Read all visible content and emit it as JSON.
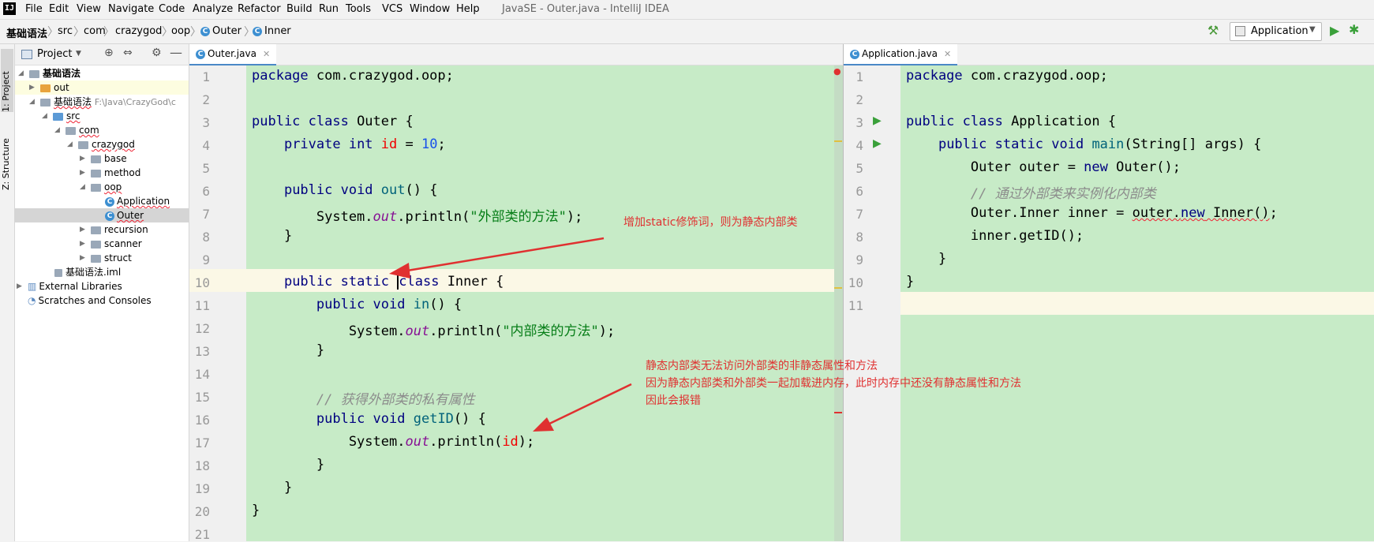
{
  "window_title": "JavaSE - Outer.java - IntelliJ IDEA",
  "menu": [
    "File",
    "Edit",
    "View",
    "Navigate",
    "Code",
    "Analyze",
    "Refactor",
    "Build",
    "Run",
    "Tools",
    "VCS",
    "Window",
    "Help"
  ],
  "breadcrumbs": [
    "基础语法",
    "src",
    "com",
    "crazygod",
    "oop",
    "Outer",
    "Inner"
  ],
  "run_config": "Application",
  "side_tabs": [
    "1: Project",
    "Z: Structure"
  ],
  "project": {
    "header": "Project",
    "tree": [
      {
        "label": "基础语法",
        "bold": true
      },
      {
        "label": "out"
      },
      {
        "label": "基础语法",
        "path": "F:\\Java\\CrazyGod\\c"
      },
      {
        "label": "src"
      },
      {
        "label": "com"
      },
      {
        "label": "crazygod"
      },
      {
        "label": "base"
      },
      {
        "label": "method"
      },
      {
        "label": "oop"
      },
      {
        "label": "Application"
      },
      {
        "label": "Outer"
      },
      {
        "label": "recursion"
      },
      {
        "label": "scanner"
      },
      {
        "label": "struct"
      },
      {
        "label": "基础语法.iml"
      },
      {
        "label": "External Libraries"
      },
      {
        "label": "Scratches and Consoles"
      }
    ]
  },
  "left_editor": {
    "tab": "Outer.java",
    "line_numbers": [
      "1",
      "2",
      "3",
      "4",
      "5",
      "6",
      "7",
      "8",
      "9",
      "10",
      "11",
      "12",
      "13",
      "14",
      "15",
      "16",
      "17",
      "18",
      "19",
      "20",
      "21"
    ]
  },
  "right_editor": {
    "tab": "Application.java",
    "line_numbers": [
      "1",
      "2",
      "3",
      "4",
      "5",
      "6",
      "7",
      "8",
      "9",
      "10",
      "11"
    ]
  },
  "annotations": {
    "a1": "增加static修饰词，则为静态内部类",
    "a2_1": "静态内部类无法访问外部类的非静态属性和方法",
    "a2_2": "因为静态内部类和外部类一起加载进内存，此时内存中还没有静态属性和方法",
    "a2_3": "因此会报错"
  },
  "colors": {
    "editor_bg": "#c7ebc7",
    "annotation": "#e03030",
    "keyword": "#000080"
  }
}
